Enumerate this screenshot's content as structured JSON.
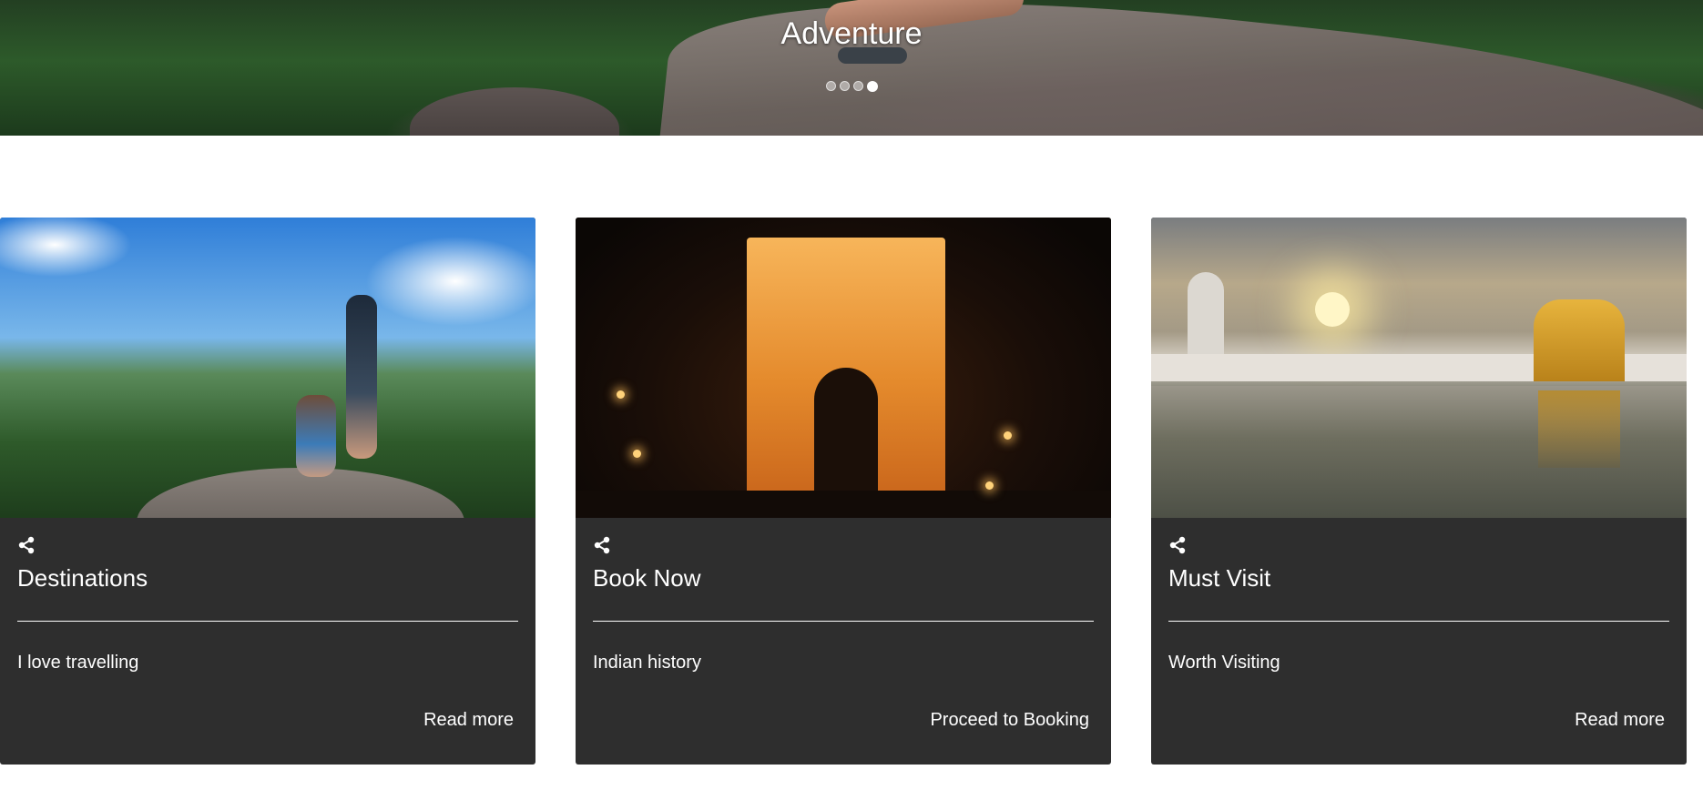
{
  "hero": {
    "caption": "Adventure",
    "slide_count": 4,
    "active_slide": 4
  },
  "cards": [
    {
      "title": "Destinations",
      "text": "I love travelling",
      "link": "Read more",
      "image": "hikers on mountain summit"
    },
    {
      "title": "Book Now",
      "text": "Indian history",
      "link": "Proceed to Booking",
      "image": "India Gate at night"
    },
    {
      "title": "Must Visit",
      "text": "Worth Visiting",
      "link": "Read more",
      "image": "Golden Temple at sunset"
    }
  ],
  "icons": {
    "share": "share-icon"
  },
  "colors": {
    "card_background": "#2e2e2e",
    "text": "#ffffff"
  }
}
